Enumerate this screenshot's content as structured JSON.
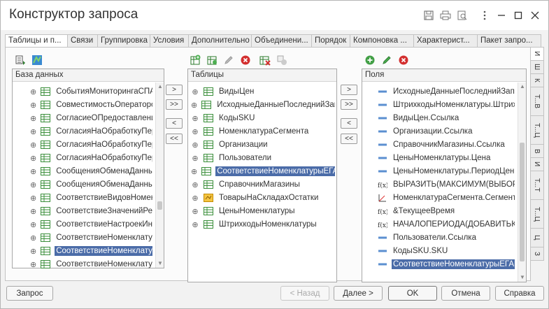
{
  "window": {
    "title": "Конструктор запроса"
  },
  "tabs": [
    {
      "label": "Таблицы и п...",
      "active": true
    },
    {
      "label": "Связи"
    },
    {
      "label": "Группировка"
    },
    {
      "label": "Условия"
    },
    {
      "label": "Дополнительно"
    },
    {
      "label": "Объединени..."
    },
    {
      "label": "Порядок"
    },
    {
      "label": "Компоновка ..."
    },
    {
      "label": "Характерист..."
    },
    {
      "label": "Пакет запро..."
    }
  ],
  "side_tabs": [
    "И",
    "Ш",
    "К",
    "Т...В",
    "Т...Ц",
    "В",
    "И",
    "Т...Т",
    "Т...Ц",
    "Ц",
    "З"
  ],
  "database_panel": {
    "header": "База данных",
    "items": [
      {
        "label": "СобытияМониторингаСПАР"
      },
      {
        "label": "СовместимостьОператоров"
      },
      {
        "label": "СогласиеОПредоставлении"
      },
      {
        "label": "СогласияНаОбработкуПерс"
      },
      {
        "label": "СогласияНаОбработкуПерс"
      },
      {
        "label": "СогласияНаОбработкуПерс"
      },
      {
        "label": "СообщенияОбменаДанным"
      },
      {
        "label": "СообщенияОбменаДанным"
      },
      {
        "label": "СоответствиеВидовНоменк"
      },
      {
        "label": "СоответствиеЗначенийРек"
      },
      {
        "label": "СоответствиеНастроекИнт"
      },
      {
        "label": "СоответствиеНоменклатур"
      },
      {
        "label": "СоответствиеНоменклатур",
        "selected": true
      },
      {
        "label": "СоответствиеНоменклатур"
      }
    ]
  },
  "move_buttons": {
    "add": ">",
    "add_all": ">>",
    "remove": "<",
    "remove_all": "<<"
  },
  "tables_panel": {
    "header": "Таблицы",
    "items": [
      {
        "label": "ВидыЦен"
      },
      {
        "label": "ИсходныеДанныеПоследнийЗапр"
      },
      {
        "label": "КодыSKU"
      },
      {
        "label": "НоменклатураСегмента"
      },
      {
        "label": "Организации"
      },
      {
        "label": "Пользователи"
      },
      {
        "label": "СоответствиеНоменклатурыЕГАИС",
        "selected": true
      },
      {
        "label": "СправочникМагазины"
      },
      {
        "label": "ТоварыНаСкладахОстатки"
      },
      {
        "label": "ЦеныНоменклатуры"
      },
      {
        "label": "ШтрихкодыНоменклатуры"
      }
    ]
  },
  "fields_panel": {
    "header": "Поля",
    "items": [
      {
        "label": "ИсходныеДанныеПоследнийЗапрос",
        "icon": "field"
      },
      {
        "label": "ШтрихкодыНоменклатуры.Штрихко",
        "icon": "field"
      },
      {
        "label": "ВидыЦен.Ссылка",
        "icon": "field"
      },
      {
        "label": "Организации.Ссылка",
        "icon": "field"
      },
      {
        "label": "СправочникМагазины.Ссылка",
        "icon": "field"
      },
      {
        "label": "ЦеныНоменклатуры.Цена",
        "icon": "field"
      },
      {
        "label": "ЦеныНоменклатуры.ПериодЦены",
        "icon": "field"
      },
      {
        "label": "ВЫРАЗИТЬ(МАКСИМУМ(ВЫБОР К",
        "icon": "func"
      },
      {
        "label": "НоменклатураСегмента.Сегмент",
        "icon": "dimension"
      },
      {
        "label": "&ТекущееВремя",
        "icon": "func"
      },
      {
        "label": "НАЧАЛОПЕРИОДА(ДОБАВИТЬКД",
        "icon": "func"
      },
      {
        "label": "Пользователи.Ссылка",
        "icon": "field"
      },
      {
        "label": "КодыSKU.SKU",
        "icon": "field"
      },
      {
        "label": "СоответствиеНоменклатурыЕГАИС",
        "icon": "field",
        "selected": true
      }
    ]
  },
  "footer": {
    "query_button": "Запрос",
    "back_button": "< Назад",
    "next_button": "Далее >",
    "ok_button": "OK",
    "cancel_button": "Отмена",
    "help_button": "Справка"
  }
}
